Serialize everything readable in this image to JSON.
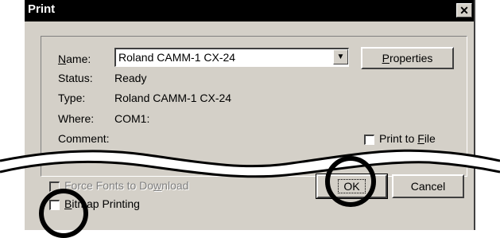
{
  "dialog": {
    "title": "Print",
    "close_glyph": "✕"
  },
  "printer": {
    "name_label": "Name:",
    "name_value": "Roland CAMM-1 CX-24",
    "properties_label": "Properties",
    "status_label": "Status:",
    "status_value": "Ready",
    "type_label": "Type:",
    "type_value": "Roland CAMM-1 CX-24",
    "where_label": "Where:",
    "where_value": "COM1:",
    "comment_label": "Comment:",
    "print_to_file_label": "Print to File"
  },
  "options": {
    "force_fonts_label": "Force Fonts to Download",
    "bitmap_label": "Bitmap Printing"
  },
  "buttons": {
    "ok": "OK",
    "cancel": "Cancel"
  },
  "colors": {
    "title_bar": "#000000",
    "dialog_bg": "#d4d0c8",
    "highlight_circle": "#000000"
  }
}
